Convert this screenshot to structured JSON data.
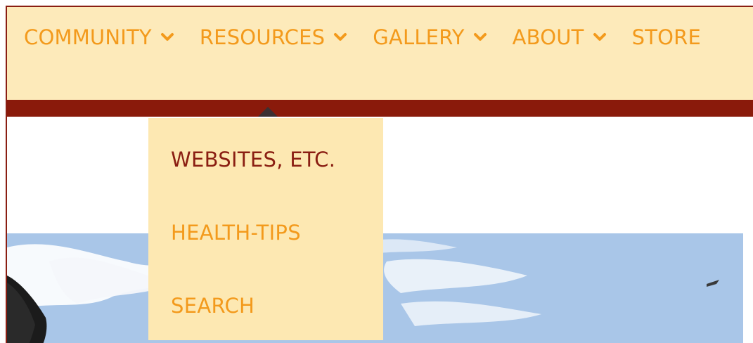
{
  "nav": {
    "items": [
      {
        "label": "COMMUNITY",
        "has_dropdown": true,
        "icon": "chevron-down-icon"
      },
      {
        "label": "RESOURCES",
        "has_dropdown": true,
        "icon": "chevron-down-icon"
      },
      {
        "label": "GALLERY",
        "has_dropdown": true,
        "icon": "chevron-down-icon"
      },
      {
        "label": "ABOUT",
        "has_dropdown": true,
        "icon": "chevron-down-icon"
      },
      {
        "label": "STORE",
        "has_dropdown": false
      }
    ]
  },
  "dropdown": {
    "items": [
      {
        "label": "WEBSITES, ETC.",
        "state": "hover"
      },
      {
        "label": "HEALTH-TIPS",
        "state": "normal"
      },
      {
        "label": "SEARCH",
        "state": "normal"
      }
    ]
  },
  "colors": {
    "nav_background": "#fdeaba",
    "nav_text": "#f39a1c",
    "accent_bar": "#8a1a0b",
    "dropdown_background": "#fde8b2",
    "dropdown_active_text": "#8a1e12",
    "sky": "#a9c6e8"
  }
}
